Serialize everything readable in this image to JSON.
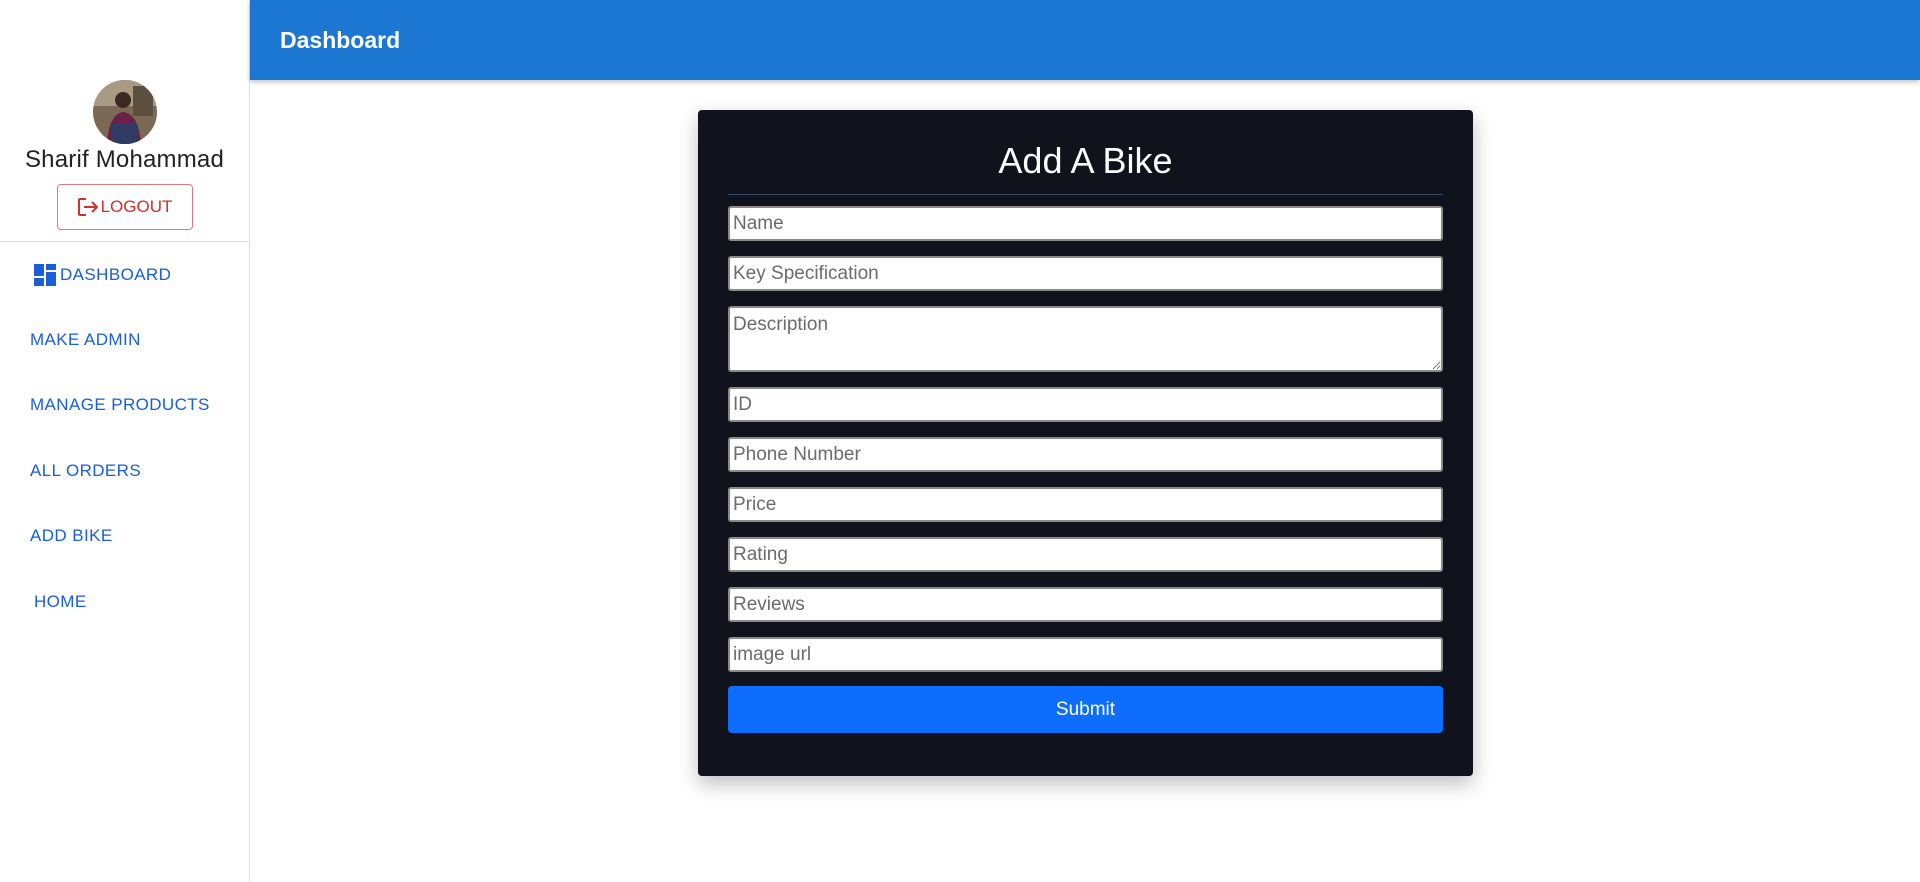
{
  "header": {
    "title": "Dashboard"
  },
  "sidebar": {
    "user_name": "Sharif Mohammad",
    "logout_label": "LOGOUT",
    "items": [
      {
        "label": "DASHBOARD",
        "icon": "dashboard-icon"
      },
      {
        "label": "MAKE ADMIN"
      },
      {
        "label": "MANAGE PRODUCTS"
      },
      {
        "label": "ALL ORDERS"
      },
      {
        "label": "ADD BIKE"
      },
      {
        "label": "HOME"
      }
    ]
  },
  "form": {
    "title": "Add A Bike",
    "fields": {
      "name": {
        "placeholder": "Name",
        "value": ""
      },
      "key_spec": {
        "placeholder": "Key Specification",
        "value": ""
      },
      "description": {
        "placeholder": "Description",
        "value": ""
      },
      "id": {
        "placeholder": "ID",
        "value": ""
      },
      "phone": {
        "placeholder": "Phone Number",
        "value": ""
      },
      "price": {
        "placeholder": "Price",
        "value": ""
      },
      "rating": {
        "placeholder": "Rating",
        "value": ""
      },
      "reviews": {
        "placeholder": "Reviews",
        "value": ""
      },
      "image_url": {
        "placeholder": "image url",
        "value": ""
      }
    },
    "submit_label": "Submit"
  },
  "colors": {
    "appbar": "#1b77d2",
    "card": "#10131c",
    "submit": "#0d6efd",
    "nav_link": "#1a5ed8",
    "logout": "#d32f2f"
  }
}
